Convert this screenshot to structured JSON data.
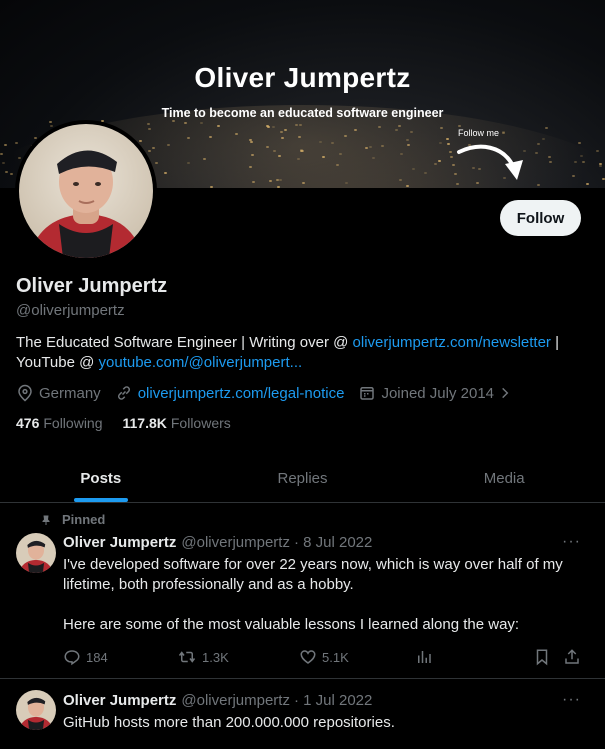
{
  "banner": {
    "title": "Oliver Jumpertz",
    "subtitle": "Time to become an educated software engineer",
    "follow_me": "Follow me"
  },
  "profile": {
    "name": "Oliver Jumpertz",
    "handle": "@oliverjumpertz",
    "follow_label": "Follow",
    "bio_line1_prefix": "The Educated Software Engineer | Writing over @ ",
    "bio_link1": "oliverjumpertz.com/newsletter",
    "bio_line1_suffix": " |",
    "bio_line2_prefix": "YouTube @ ",
    "bio_link2": "youtube.com/@oliverjumpert...",
    "location": "Germany",
    "website": "oliverjumpertz.com/legal-notice",
    "joined": "Joined July 2014",
    "following_count": "476",
    "following_label": "Following",
    "followers_count": "117.8K",
    "followers_label": "Followers"
  },
  "tabs": [
    {
      "label": "Posts",
      "active": true
    },
    {
      "label": "Replies",
      "active": false
    },
    {
      "label": "Media",
      "active": false
    }
  ],
  "tweets": [
    {
      "pinned_label": "Pinned",
      "name": "Oliver Jumpertz",
      "handle": "@oliverjumpertz",
      "date": "· 8 Jul 2022",
      "text1": "I've developed software for over 22 years now, which is way over half of my lifetime, both professionally and as a hobby.",
      "text2": "Here are some of the most valuable lessons I learned along the way:",
      "replies": "184",
      "reposts": "1.3K",
      "likes": "5.1K"
    },
    {
      "name": "Oliver Jumpertz",
      "handle": "@oliverjumpertz",
      "date": "· 1 Jul 2022",
      "text1": "GitHub hosts more than 200.000.000 repositories."
    }
  ],
  "more_glyph": "···",
  "colors": {
    "accent": "#1d9bf0",
    "muted": "#71767b",
    "text": "#e7e9ea",
    "divider": "#2f3336"
  },
  "icons": [
    "location-icon",
    "link-icon",
    "calendar-icon",
    "chevron-right-icon",
    "pin-icon",
    "reply-icon",
    "repost-icon",
    "like-icon",
    "views-icon",
    "bookmark-icon",
    "share-icon",
    "more-icon"
  ]
}
